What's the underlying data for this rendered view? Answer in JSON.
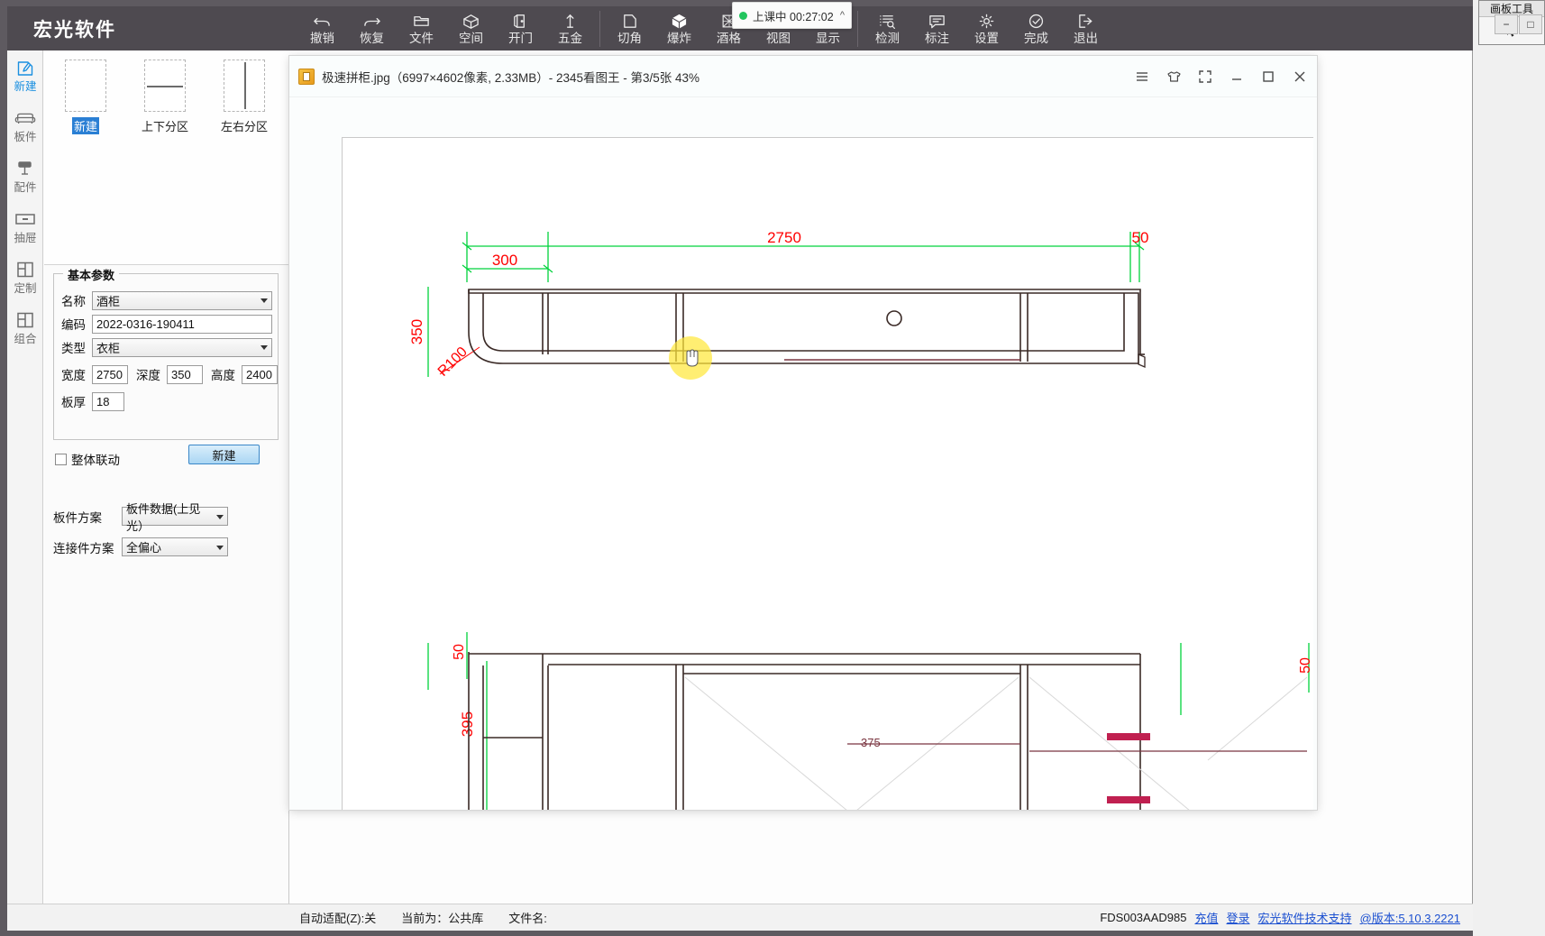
{
  "app": {
    "brand": "宏光软件"
  },
  "toolbar": {
    "items": [
      {
        "label": "撤销",
        "icon": "undo-icon"
      },
      {
        "label": "恢复",
        "icon": "redo-icon"
      },
      {
        "label": "文件",
        "icon": "folder-icon"
      },
      {
        "label": "空间",
        "icon": "cube-icon"
      },
      {
        "label": "开门",
        "icon": "door-icon"
      },
      {
        "label": "五金",
        "icon": "hardware-icon"
      },
      {
        "label": "切角",
        "icon": "corner-cut-icon"
      },
      {
        "label": "爆炸",
        "icon": "explode-icon"
      },
      {
        "label": "酒格",
        "icon": "wine-grid-icon"
      },
      {
        "label": "视图",
        "icon": "view-icon"
      },
      {
        "label": "显示",
        "icon": "display-icon"
      },
      {
        "label": "检测",
        "icon": "inspect-icon"
      },
      {
        "label": "标注",
        "icon": "annotate-icon"
      },
      {
        "label": "设置",
        "icon": "gear-icon"
      },
      {
        "label": "完成",
        "icon": "check-circle-icon"
      },
      {
        "label": "退出",
        "icon": "exit-icon"
      }
    ]
  },
  "class_pill": {
    "status": "上课中",
    "timer": "00:27:02",
    "caret": "chevron-up-icon",
    "dot_color": "#22c55e"
  },
  "window_controls": {
    "minimize": "−",
    "maximize": "□",
    "close": "✕"
  },
  "palette": {
    "title": "画板工具",
    "cursor_icon": "arrow-cursor-icon"
  },
  "rail": {
    "items": [
      {
        "label": "新建",
        "icon": "new-pencil-icon",
        "active": true
      },
      {
        "label": "板件",
        "icon": "panel-icon",
        "active": false
      },
      {
        "label": "配件",
        "icon": "accessory-icon",
        "active": false
      },
      {
        "label": "抽屉",
        "icon": "drawer-icon",
        "active": false
      },
      {
        "label": "定制",
        "icon": "custom-icon",
        "active": false
      },
      {
        "label": "组合",
        "icon": "combine-icon",
        "active": false
      }
    ]
  },
  "left_panel": {
    "thumbnails": [
      {
        "label": "新建",
        "divider": "none",
        "selected": true
      },
      {
        "label": "上下分区",
        "divider": "horizontal",
        "selected": false
      },
      {
        "label": "左右分区",
        "divider": "vertical",
        "selected": false
      }
    ],
    "params_group_title": "基本参数",
    "fields": {
      "name_label": "名称",
      "name_value": "酒柜",
      "code_label": "编码",
      "code_value": "2022-0316-190411",
      "type_label": "类型",
      "type_value": "衣柜",
      "width_label": "宽度",
      "width_value": "2750",
      "depth_label": "深度",
      "depth_value": "350",
      "height_label": "高度",
      "height_value": "2400",
      "thickness_label": "板厚",
      "thickness_value": "18"
    },
    "linkage_label": "整体联动",
    "new_button": "新建",
    "panel_scheme_label": "板件方案",
    "panel_scheme_value": "板件数据(上见光）",
    "connector_scheme_label": "连接件方案",
    "connector_scheme_value": "全偏心"
  },
  "viewer": {
    "title": "极速拼柜.jpg（6997×4602像素, 2.33MB）- 2345看图王 - 第3/5张 43%",
    "controls": [
      {
        "icon": "menu-hamburger-icon"
      },
      {
        "icon": "shirt-skin-icon"
      },
      {
        "icon": "fullscreen-icon"
      },
      {
        "icon": "minimize-icon"
      },
      {
        "icon": "maximize-icon"
      },
      {
        "icon": "close-icon"
      }
    ]
  },
  "drawing": {
    "dimensions": {
      "total_width": "2750",
      "right_offset": "50",
      "left_segment": "300",
      "depth": "350",
      "radius": "R100",
      "top_offset": "50",
      "lower_height": "395",
      "inner_label": "375",
      "far_right": "50"
    },
    "colors": {
      "dimension": "#ff0000",
      "extension": "#00d23c",
      "outline": "#3a2a26",
      "accent": "#c02050"
    }
  },
  "status_bar": {
    "auto_fit": "自动适配(Z):关",
    "current_library": "当前为：公共库",
    "file_name": "文件名:",
    "machine_code": "FDS003AAD985",
    "recharge": "充值",
    "login": "登录",
    "support": "宏光软件技术支持",
    "version": "@版本:5.10.3.2221"
  }
}
